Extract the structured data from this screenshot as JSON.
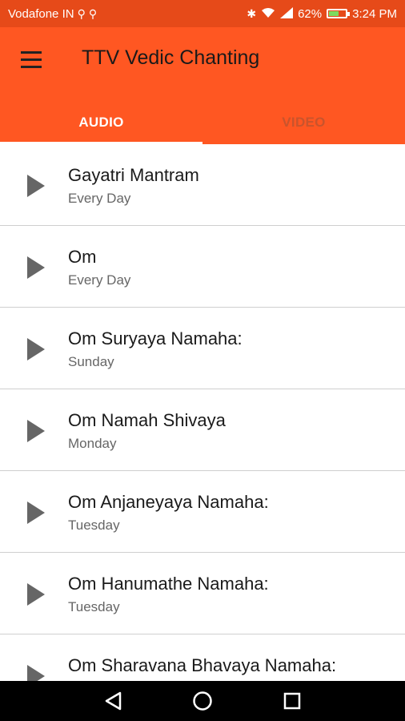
{
  "status_bar": {
    "carrier": "Vodafone IN",
    "battery": "62%",
    "battery_level": 0.62,
    "time": "3:24 PM"
  },
  "app_bar": {
    "title": "TTV Vedic Chanting",
    "tabs": [
      {
        "label": "AUDIO",
        "active": true
      },
      {
        "label": "VIDEO",
        "active": false
      }
    ]
  },
  "items": [
    {
      "title": "Gayatri Mantram",
      "subtitle": "Every Day"
    },
    {
      "title": "Om",
      "subtitle": "Every Day"
    },
    {
      "title": "Om Suryaya Namaha:",
      "subtitle": "Sunday"
    },
    {
      "title": "Om Namah Shivaya",
      "subtitle": "Monday"
    },
    {
      "title": "Om Anjaneyaya Namaha:",
      "subtitle": "Tuesday"
    },
    {
      "title": "Om Hanumathe Namaha:",
      "subtitle": "Tuesday"
    },
    {
      "title": "Om Sharavana Bhavaya Namaha:",
      "subtitle": ""
    }
  ],
  "colors": {
    "status_bar": "#e64a19",
    "app_bar": "#ff5722",
    "play_icon": "#666666"
  },
  "icons": {
    "menu": "hamburger-menu-icon",
    "play": "play-icon",
    "back": "back-triangle-icon",
    "home": "home-circle-icon",
    "recents": "recents-square-icon"
  }
}
